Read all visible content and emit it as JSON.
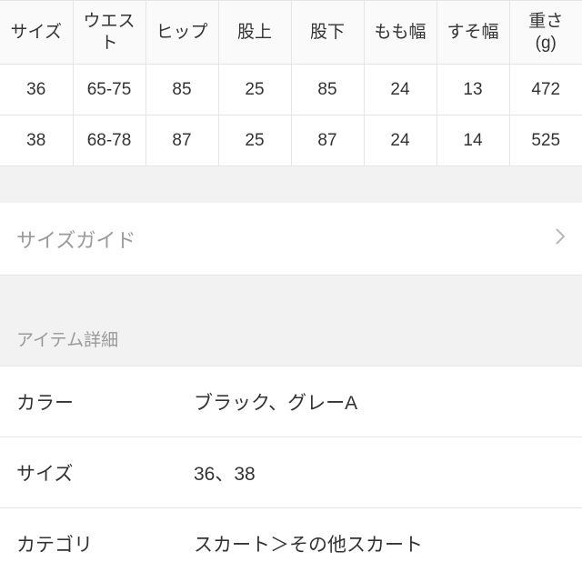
{
  "size_table": {
    "headers": [
      "サイズ",
      "ウエス\nト",
      "ヒップ",
      "股上",
      "股下",
      "もも幅",
      "すそ幅",
      "重さ\n(g)"
    ],
    "rows": [
      [
        "36",
        "65-75",
        "85",
        "25",
        "85",
        "24",
        "13",
        "472"
      ],
      [
        "38",
        "68-78",
        "87",
        "25",
        "87",
        "24",
        "14",
        "525"
      ]
    ]
  },
  "size_guide": {
    "label": "サイズガイド"
  },
  "item_details": {
    "header": "アイテム詳細",
    "rows": [
      {
        "key": "カラー",
        "val": "ブラック、グレーA"
      },
      {
        "key": "サイズ",
        "val": "36、38"
      },
      {
        "key": "カテゴリ",
        "val": "スカート＞その他スカート"
      }
    ]
  }
}
